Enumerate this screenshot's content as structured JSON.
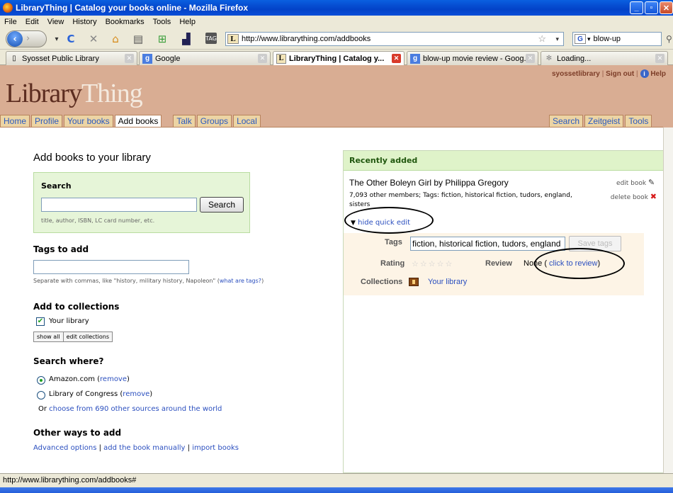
{
  "window": {
    "title": "LibraryThing | Catalog your books online - Mozilla Firefox"
  },
  "menu": [
    "File",
    "Edit",
    "View",
    "History",
    "Bookmarks",
    "Tools",
    "Help"
  ],
  "urlbar": {
    "url": "http://www.librarything.com/addbooks",
    "site_icon_letter": "L"
  },
  "searchbar": {
    "value": "blow-up",
    "engine_letter": "G"
  },
  "toolbar_icons": [
    "reload-icon",
    "stop-icon",
    "home-icon",
    "print-icon",
    "addon-icon",
    "window-icon",
    "tag-icon"
  ],
  "tabs": [
    {
      "label": "Syosset Public Library",
      "active": false
    },
    {
      "label": "Google",
      "active": false
    },
    {
      "label": "LibraryThing | Catalog y...",
      "active": true
    },
    {
      "label": "blow-up movie review - Goog...",
      "active": false
    },
    {
      "label": "Loading...",
      "active": false
    }
  ],
  "header": {
    "logo_library": "Library",
    "logo_thing": "Thing",
    "user": "syossetlibrary",
    "sep1": "|",
    "signout": "Sign out",
    "sep2": "|",
    "help": "Help",
    "nav_left": [
      "Home",
      "Profile",
      "Your books",
      "Add books",
      "Talk",
      "Groups",
      "Local"
    ],
    "nav_right": [
      "Search",
      "Zeitgeist",
      "Tools"
    ],
    "active_nav": "Add books"
  },
  "left": {
    "heading": "Add books to your library",
    "search": {
      "label": "Search",
      "value": "",
      "button": "Search",
      "hint": "title, author, ISBN, LC card number, etc."
    },
    "tags": {
      "heading": "Tags to add",
      "value": "",
      "hint_prefix": "Separate with commas, like \"history, military history, Napoleon\" (",
      "hint_link": "what are tags?",
      "hint_suffix": ")"
    },
    "collections": {
      "heading": "Add to collections",
      "item": "Your library",
      "checked": true,
      "show_all": "show all",
      "edit": "edit collections"
    },
    "where": {
      "heading": "Search where?",
      "opt1_label": "Amazon.com (",
      "opt1_link": "remove",
      "opt1_end": ")",
      "opt2_label": "Library of Congress (",
      "opt2_link": "remove",
      "opt2_end": ")",
      "or_prefix": "Or ",
      "or_link": "choose from 690 other sources around the world"
    },
    "other": {
      "heading": "Other ways to add",
      "link1": "Advanced options",
      "sep": "|",
      "link2": "add the book manually",
      "link3": "import books"
    }
  },
  "right": {
    "heading": "Recently added",
    "book_title": "The Other Boleyn Girl by Philippa Gregory",
    "book_meta": "7,093 other members; Tags: fiction, historical fiction, tudors, england, sisters",
    "edit_book": "edit book",
    "delete_book": "delete book",
    "hide_quick_edit": "hide quick edit",
    "tags_label": "Tags",
    "tags_value": "fiction, historical fiction, tudors, england",
    "save_tags": "Save tags",
    "rating_label": "Rating",
    "rating_stars": "☆☆☆☆☆",
    "review_label": "Review",
    "review_value": "None (",
    "click_to_review": "click to review",
    "review_end": ")",
    "collections_label": "Collections",
    "collection_value": "Your library"
  },
  "status": {
    "text": "http://www.librarything.com/addbooks#"
  }
}
